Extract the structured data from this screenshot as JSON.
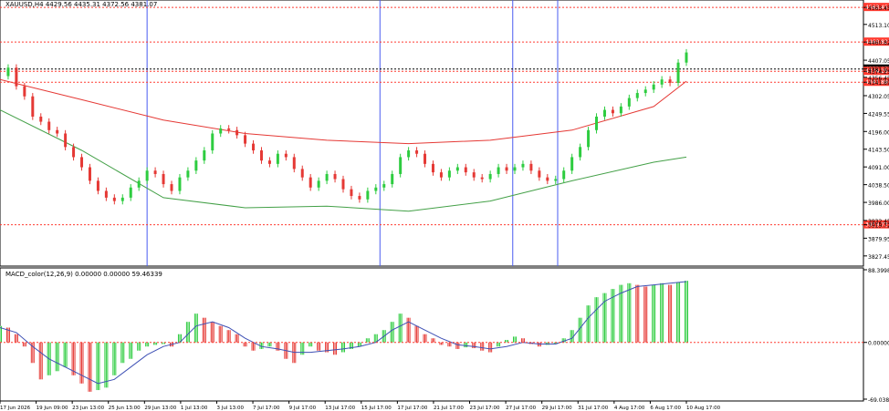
{
  "chart_data": [
    {
      "type": "candlestick",
      "header": "XAUUSD,H4  4429.56 4435.31 4372.56 4381.07",
      "y_ticks": [
        "4563.45",
        "4513.10",
        "4460.82",
        "4407.05",
        "4381.07",
        "4374.25",
        "4356.45",
        "4341.89",
        "4302.05",
        "4249.55",
        "4196.00",
        "4143.50",
        "4091.00",
        "4038.50",
        "3986.00",
        "3932.45",
        "3919.72",
        "3879.95",
        "3827.45"
      ],
      "y_range": [
        3800,
        4580
      ],
      "level_labels": [
        {
          "value": 4563.45,
          "label": "4563.45",
          "color": "#ff3b30"
        },
        {
          "value": 4460.82,
          "label": "4460.82",
          "color": "#ff3b30"
        },
        {
          "value": 4381.07,
          "label": "4381.07",
          "color": "#000000"
        },
        {
          "value": 4374.25,
          "label": "4374.25",
          "color": "#ff3b30"
        },
        {
          "value": 4341.89,
          "label": "4341.89",
          "color": "#ff3b30"
        },
        {
          "value": 3919.72,
          "label": "3919.72",
          "color": "#ff3b30"
        }
      ],
      "x_ticks": [
        "17 Jun 2026",
        "19 Jun 09:00",
        "23 Jun 13:00",
        "25 Jun 13:00",
        "29 Jun 13:00",
        "1 Jul 13:00",
        "3 Jul 13:00",
        "7 Jul 17:00",
        "9 Jul 17:00",
        "13 Jul 17:00",
        "15 Jul 17:00",
        "17 Jul 17:00",
        "21 Jul 17:00",
        "23 Jul 17:00",
        "27 Jul 17:00",
        "29 Jul 17:00",
        "31 Jul 17:00",
        "4 Aug 17:00",
        "6 Aug 17:00",
        "10 Aug 17:00"
      ],
      "close_path": [
        [
          0,
          4360
        ],
        [
          4,
          4385
        ],
        [
          8,
          4330
        ],
        [
          12,
          4300
        ],
        [
          16,
          4240
        ],
        [
          20,
          4225
        ],
        [
          24,
          4200
        ],
        [
          28,
          4190
        ],
        [
          32,
          4150
        ],
        [
          36,
          4120
        ],
        [
          40,
          4090
        ],
        [
          44,
          4050
        ],
        [
          48,
          4020
        ],
        [
          52,
          4000
        ],
        [
          56,
          3990
        ],
        [
          60,
          4000
        ],
        [
          64,
          4030
        ],
        [
          68,
          4050
        ],
        [
          72,
          4080
        ],
        [
          76,
          4070
        ],
        [
          80,
          4040
        ],
        [
          84,
          4020
        ],
        [
          88,
          4060
        ],
        [
          92,
          4080
        ],
        [
          96,
          4110
        ],
        [
          100,
          4140
        ],
        [
          104,
          4190
        ],
        [
          108,
          4205
        ],
        [
          112,
          4200
        ],
        [
          116,
          4185
        ],
        [
          120,
          4160
        ],
        [
          124,
          4140
        ],
        [
          128,
          4110
        ],
        [
          132,
          4100
        ],
        [
          136,
          4130
        ],
        [
          140,
          4120
        ],
        [
          144,
          4085
        ],
        [
          148,
          4060
        ],
        [
          152,
          4030
        ],
        [
          156,
          4050
        ],
        [
          160,
          4070
        ],
        [
          164,
          4055
        ],
        [
          168,
          4025
        ],
        [
          172,
          4005
        ],
        [
          176,
          3995
        ],
        [
          180,
          4020
        ],
        [
          184,
          4030
        ],
        [
          188,
          4040
        ],
        [
          192,
          4070
        ],
        [
          196,
          4120
        ],
        [
          200,
          4140
        ],
        [
          204,
          4130
        ],
        [
          208,
          4100
        ],
        [
          212,
          4075
        ],
        [
          216,
          4060
        ],
        [
          220,
          4080
        ],
        [
          224,
          4090
        ],
        [
          228,
          4075
        ],
        [
          232,
          4060
        ],
        [
          236,
          4055
        ],
        [
          240,
          4070
        ],
        [
          244,
          4090
        ],
        [
          248,
          4080
        ],
        [
          252,
          4090
        ],
        [
          256,
          4100
        ],
        [
          260,
          4080
        ],
        [
          264,
          4060
        ],
        [
          268,
          4050
        ],
        [
          272,
          4055
        ],
        [
          276,
          4080
        ],
        [
          280,
          4120
        ],
        [
          284,
          4150
        ],
        [
          288,
          4200
        ],
        [
          292,
          4240
        ],
        [
          296,
          4260
        ],
        [
          300,
          4250
        ],
        [
          304,
          4270
        ],
        [
          308,
          4295
        ],
        [
          312,
          4310
        ],
        [
          316,
          4320
        ],
        [
          320,
          4335
        ],
        [
          324,
          4350
        ],
        [
          328,
          4340
        ],
        [
          332,
          4400
        ],
        [
          336,
          4430
        ]
      ],
      "lines": {
        "ma_red": [
          [
            0,
            4350
          ],
          [
            40,
            4290
          ],
          [
            80,
            4230
          ],
          [
            120,
            4190
          ],
          [
            160,
            4170
          ],
          [
            200,
            4160
          ],
          [
            240,
            4170
          ],
          [
            280,
            4200
          ],
          [
            320,
            4270
          ],
          [
            336,
            4345
          ]
        ],
        "ma_green": [
          [
            0,
            4260
          ],
          [
            40,
            4140
          ],
          [
            80,
            4000
          ],
          [
            120,
            3970
          ],
          [
            160,
            3975
          ],
          [
            200,
            3960
          ],
          [
            240,
            3990
          ],
          [
            280,
            4050
          ],
          [
            320,
            4105
          ],
          [
            336,
            4120
          ]
        ]
      },
      "macd": {
        "label": "MACD_color(12,26,9) 0.00000 0.00000 59.46339",
        "y_ticks": [
          "88.39989",
          "0.00000",
          "-69.03859"
        ],
        "y_range": [
          -69.03859,
          88.39989
        ],
        "hist": [
          [
            0,
            20
          ],
          [
            4,
            18
          ],
          [
            8,
            10
          ],
          [
            12,
            -5
          ],
          [
            16,
            -25
          ],
          [
            20,
            -45
          ],
          [
            24,
            -40
          ],
          [
            28,
            -35
          ],
          [
            32,
            -30
          ],
          [
            36,
            -40
          ],
          [
            40,
            -50
          ],
          [
            44,
            -60
          ],
          [
            48,
            -58
          ],
          [
            52,
            -55
          ],
          [
            56,
            -40
          ],
          [
            60,
            -25
          ],
          [
            64,
            -20
          ],
          [
            68,
            -10
          ],
          [
            72,
            -5
          ],
          [
            76,
            -3
          ],
          [
            80,
            -2
          ],
          [
            84,
            -5
          ],
          [
            88,
            10
          ],
          [
            92,
            25
          ],
          [
            96,
            35
          ],
          [
            100,
            30
          ],
          [
            104,
            25
          ],
          [
            108,
            20
          ],
          [
            112,
            15
          ],
          [
            116,
            10
          ],
          [
            120,
            -5
          ],
          [
            124,
            -10
          ],
          [
            128,
            -8
          ],
          [
            132,
            -5
          ],
          [
            136,
            -10
          ],
          [
            140,
            -20
          ],
          [
            144,
            -25
          ],
          [
            148,
            -15
          ],
          [
            152,
            -5
          ],
          [
            156,
            -10
          ],
          [
            160,
            -12
          ],
          [
            164,
            -15
          ],
          [
            168,
            -12
          ],
          [
            172,
            -8
          ],
          [
            176,
            -5
          ],
          [
            180,
            5
          ],
          [
            184,
            10
          ],
          [
            188,
            15
          ],
          [
            192,
            25
          ],
          [
            196,
            35
          ],
          [
            200,
            30
          ],
          [
            204,
            20
          ],
          [
            208,
            10
          ],
          [
            212,
            5
          ],
          [
            216,
            -3
          ],
          [
            220,
            -5
          ],
          [
            224,
            -8
          ],
          [
            228,
            -6
          ],
          [
            232,
            -7
          ],
          [
            236,
            -10
          ],
          [
            240,
            -12
          ],
          [
            244,
            -5
          ],
          [
            248,
            3
          ],
          [
            252,
            7
          ],
          [
            256,
            5
          ],
          [
            260,
            -2
          ],
          [
            264,
            -5
          ],
          [
            268,
            -3
          ],
          [
            272,
            -2
          ],
          [
            276,
            5
          ],
          [
            280,
            15
          ],
          [
            284,
            30
          ],
          [
            288,
            45
          ],
          [
            292,
            55
          ],
          [
            296,
            60
          ],
          [
            300,
            65
          ],
          [
            304,
            70
          ],
          [
            308,
            72
          ],
          [
            312,
            70
          ],
          [
            316,
            68
          ],
          [
            320,
            70
          ],
          [
            324,
            72
          ],
          [
            328,
            70
          ],
          [
            332,
            73
          ],
          [
            336,
            75
          ]
        ],
        "signal": [
          [
            0,
            18
          ],
          [
            8,
            12
          ],
          [
            16,
            -5
          ],
          [
            24,
            -20
          ],
          [
            32,
            -30
          ],
          [
            40,
            -40
          ],
          [
            48,
            -50
          ],
          [
            56,
            -45
          ],
          [
            64,
            -30
          ],
          [
            72,
            -15
          ],
          [
            80,
            -5
          ],
          [
            88,
            0
          ],
          [
            96,
            20
          ],
          [
            104,
            25
          ],
          [
            112,
            18
          ],
          [
            120,
            5
          ],
          [
            128,
            -5
          ],
          [
            136,
            -8
          ],
          [
            144,
            -12
          ],
          [
            152,
            -12
          ],
          [
            160,
            -10
          ],
          [
            168,
            -8
          ],
          [
            176,
            -5
          ],
          [
            184,
            0
          ],
          [
            192,
            15
          ],
          [
            200,
            25
          ],
          [
            208,
            15
          ],
          [
            216,
            5
          ],
          [
            224,
            -3
          ],
          [
            232,
            -5
          ],
          [
            240,
            -8
          ],
          [
            248,
            -5
          ],
          [
            256,
            0
          ],
          [
            264,
            -2
          ],
          [
            272,
            -2
          ],
          [
            280,
            5
          ],
          [
            288,
            30
          ],
          [
            296,
            50
          ],
          [
            304,
            60
          ],
          [
            312,
            68
          ],
          [
            320,
            70
          ],
          [
            328,
            72
          ],
          [
            336,
            74
          ]
        ]
      }
    }
  ]
}
